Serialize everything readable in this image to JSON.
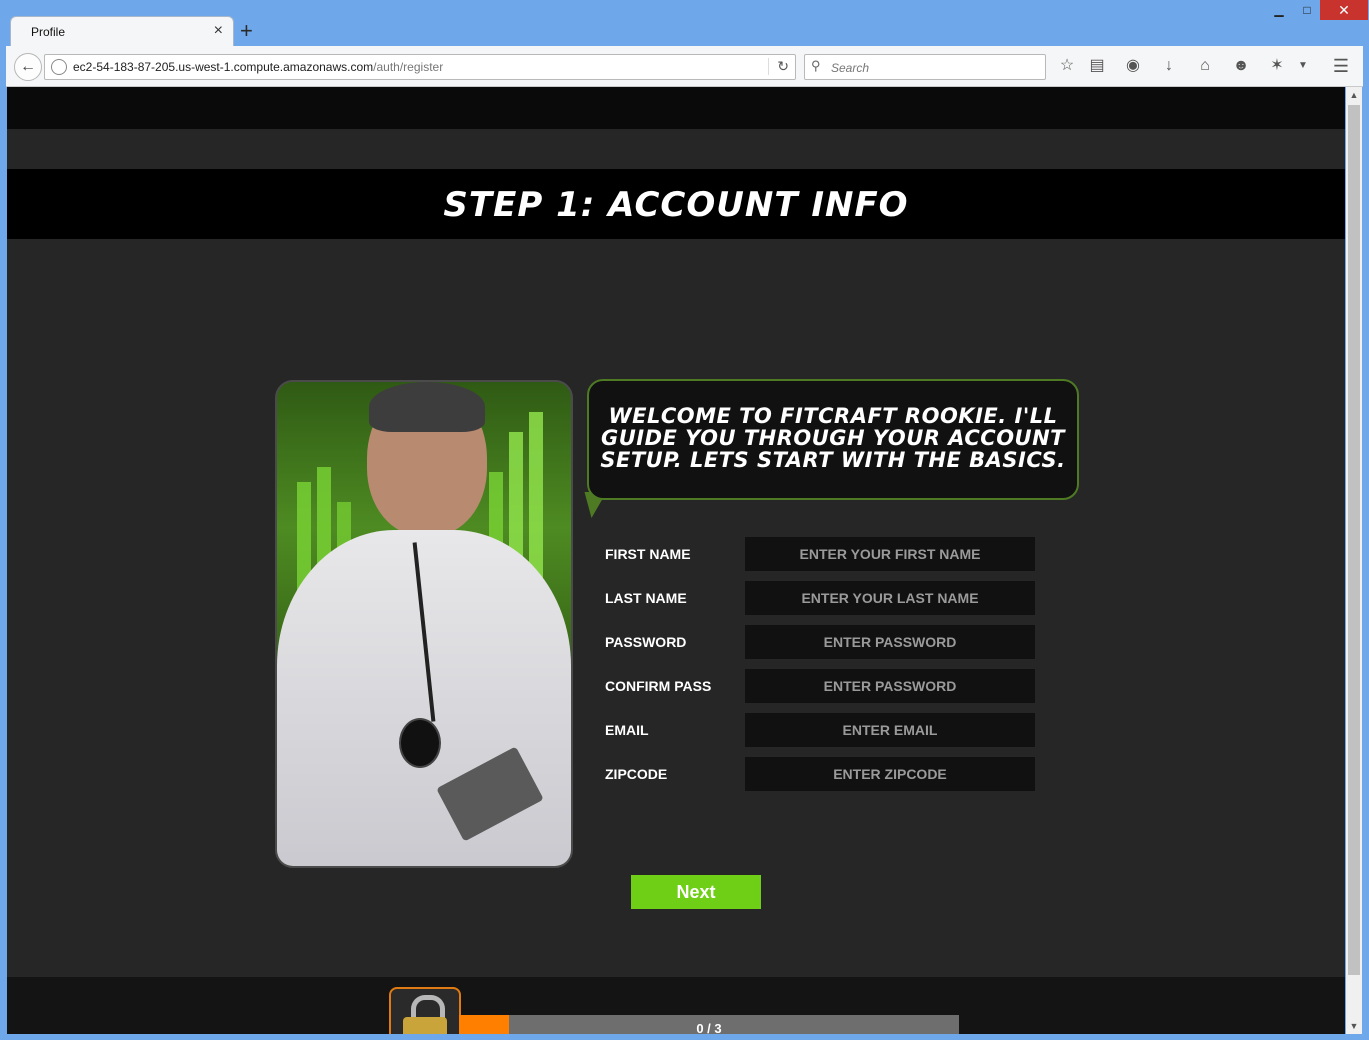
{
  "browser": {
    "tab_title": "Profile",
    "tab_close": "×",
    "new_tab": "+",
    "url_host": "ec2-54-183-87-205.us-west-1.compute.amazonaws.com",
    "url_path": "/auth/register",
    "search_placeholder": "Search",
    "window_buttons": {
      "minimize": "▁",
      "maximize": "□",
      "close": "✕"
    },
    "toolbar_icons": [
      "star-icon",
      "reading-list-icon",
      "pocket-icon",
      "download-icon",
      "home-icon",
      "chat-icon",
      "extension-icon",
      "menu-icon"
    ]
  },
  "page": {
    "step_title": "STEP 1: ACCOUNT INFO",
    "bubble_text": "WELCOME TO FITCRAFT ROOKIE.  I'LL GUIDE YOU THROUGH YOUR ACCOUNT SETUP.  LETS START WITH THE BASICS.",
    "form": {
      "fields": [
        {
          "label": "FIRST NAME",
          "placeholder": "ENTER YOUR FIRST NAME",
          "value": ""
        },
        {
          "label": "LAST NAME",
          "placeholder": "ENTER YOUR LAST NAME",
          "value": ""
        },
        {
          "label": "PASSWORD",
          "placeholder": "ENTER PASSWORD",
          "value": ""
        },
        {
          "label": "CONFIRM PASS",
          "placeholder": "ENTER PASSWORD",
          "value": ""
        },
        {
          "label": "EMAIL",
          "placeholder": "ENTER EMAIL",
          "value": ""
        },
        {
          "label": "ZIPCODE",
          "placeholder": "ENTER ZIPCODE",
          "value": ""
        }
      ]
    },
    "next_label": "Next",
    "progress": {
      "text": "0 / 3",
      "fraction": 0.1
    }
  },
  "colors": {
    "accent_green": "#6fcf17",
    "progress_orange": "#ff7f00",
    "bubble_border": "#4e7a24"
  }
}
